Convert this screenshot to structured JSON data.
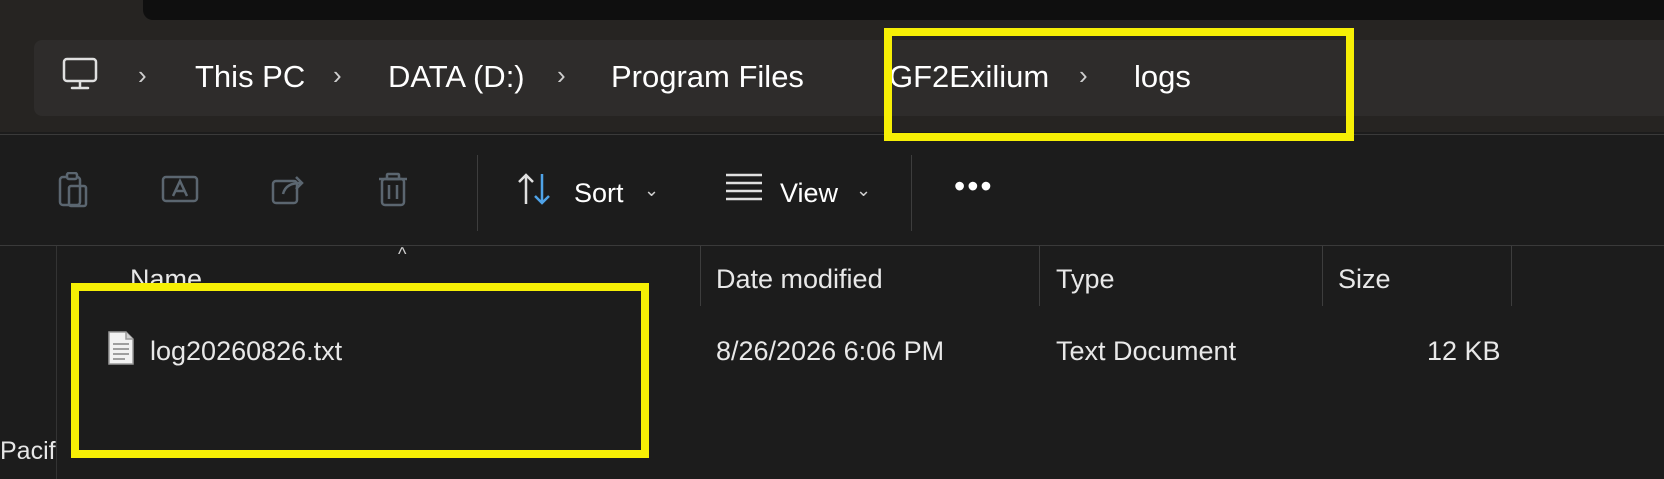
{
  "breadcrumb": {
    "items": [
      "This PC",
      "DATA (D:)",
      "Program Files",
      "GF2Exilium",
      "logs"
    ]
  },
  "toolbar": {
    "sort_label": "Sort",
    "view_label": "View",
    "more_label": "•••"
  },
  "columns": {
    "name": "Name",
    "date_modified": "Date modified",
    "type": "Type",
    "size": "Size"
  },
  "files": [
    {
      "name": "log20260826.txt",
      "date_modified": "8/26/2026 6:06 PM",
      "type": "Text Document",
      "size": "12 KB"
    }
  ],
  "nav_pane": {
    "partial_text": "Pacif"
  },
  "colors": {
    "highlight": "#f6ef05",
    "background": "#1c1c1c",
    "address_bar": "#2e2c2b"
  },
  "icons": [
    "computer-icon",
    "chevron-right-icon",
    "copy-icon",
    "rename-icon",
    "share-icon",
    "delete-icon",
    "sort-icon",
    "view-icon",
    "more-icon",
    "text-file-icon",
    "sort-up-icon"
  ]
}
